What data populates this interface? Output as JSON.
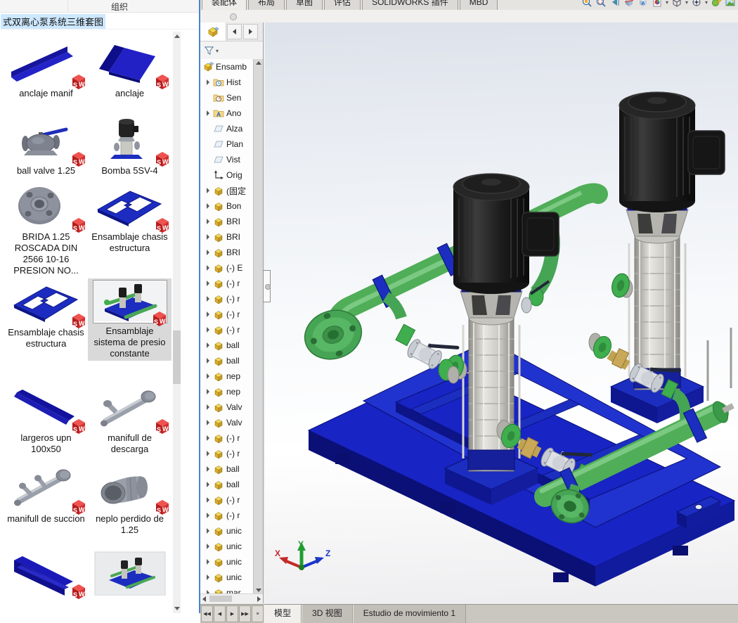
{
  "explorer": {
    "toolbar": {
      "organize": "组织"
    },
    "filename": "式双离心泵系统三维套图",
    "items": [
      {
        "label": "anclaje manif",
        "thumb": "angle-thin",
        "selected": false
      },
      {
        "label": "anclaje",
        "thumb": "angle-wide",
        "selected": false
      },
      {
        "label": "ball valve 1.25",
        "thumb": "ball-valve",
        "selected": false
      },
      {
        "label": "Bomba 5SV-4",
        "thumb": "pump-vertical",
        "selected": false
      },
      {
        "label": "BRIDA 1.25 ROSCADA DIN 2566 10-16 PRESION NO...",
        "thumb": "flange",
        "selected": false
      },
      {
        "label": "Ensamblaje chasis estructura",
        "thumb": "chassis",
        "selected": false
      },
      {
        "label": "Ensamblaje chasis estructura",
        "thumb": "chassis",
        "selected": false
      },
      {
        "label": "Ensamblaje sistema de presio constante",
        "thumb": "pump-skid",
        "selected": true
      },
      {
        "label": "largeros upn 100x50",
        "thumb": "channel-long",
        "selected": false
      },
      {
        "label": "manifull de descarga",
        "thumb": "manifold-descarga",
        "selected": false
      },
      {
        "label": "manifull de succion",
        "thumb": "manifold-succion",
        "selected": false
      },
      {
        "label": "neplo perdido de 1.25",
        "thumb": "coupling",
        "selected": false
      },
      {
        "label": "",
        "thumb": "channel-big",
        "selected": false
      },
      {
        "label": "",
        "thumb": "skid-photo",
        "selected": false
      }
    ]
  },
  "solidworks": {
    "commandmanager_tabs": [
      "装配体",
      "布局",
      "草图",
      "评估",
      "SOLIDWORKS 插件",
      "MBD"
    ],
    "headsup_icons": [
      "zoom-fit",
      "zoom-area",
      "previous-view",
      "section-view",
      "annotation-view",
      "appearance",
      "display-style",
      "view-orientation",
      "edit-appearance",
      "apply-scene"
    ],
    "featuretree": {
      "items": [
        {
          "icon": "assembly",
          "label": "Ensamb",
          "arrow": false,
          "indent": 0
        },
        {
          "icon": "history",
          "label": "Hist",
          "arrow": true,
          "indent": 1
        },
        {
          "icon": "sensors",
          "label": "Sen",
          "arrow": false,
          "indent": 1
        },
        {
          "icon": "annotations",
          "label": "Ano",
          "arrow": true,
          "indent": 1
        },
        {
          "icon": "plane",
          "label": "Alza",
          "arrow": false,
          "indent": 1
        },
        {
          "icon": "plane",
          "label": "Plan",
          "arrow": false,
          "indent": 1
        },
        {
          "icon": "plane",
          "label": "Vist",
          "arrow": false,
          "indent": 1
        },
        {
          "icon": "origin",
          "label": "Orig",
          "arrow": false,
          "indent": 1
        },
        {
          "icon": "part",
          "label": "(固定",
          "arrow": true,
          "indent": 1
        },
        {
          "icon": "part",
          "label": "Bon",
          "arrow": true,
          "indent": 1
        },
        {
          "icon": "part",
          "label": "BRI",
          "arrow": true,
          "indent": 1
        },
        {
          "icon": "part",
          "label": "BRI",
          "arrow": true,
          "indent": 1
        },
        {
          "icon": "part",
          "label": "BRI",
          "arrow": true,
          "indent": 1
        },
        {
          "icon": "part",
          "label": "(-) E",
          "arrow": true,
          "indent": 1
        },
        {
          "icon": "part",
          "label": "(-) r",
          "arrow": true,
          "indent": 1
        },
        {
          "icon": "part",
          "label": "(-) r",
          "arrow": true,
          "indent": 1
        },
        {
          "icon": "part",
          "label": "(-) r",
          "arrow": true,
          "indent": 1
        },
        {
          "icon": "part",
          "label": "(-) r",
          "arrow": true,
          "indent": 1
        },
        {
          "icon": "part",
          "label": "ball",
          "arrow": true,
          "indent": 1
        },
        {
          "icon": "part",
          "label": "ball",
          "arrow": true,
          "indent": 1
        },
        {
          "icon": "part",
          "label": "nep",
          "arrow": true,
          "indent": 1
        },
        {
          "icon": "part",
          "label": "nep",
          "arrow": true,
          "indent": 1
        },
        {
          "icon": "part",
          "label": "Valv",
          "arrow": true,
          "indent": 1
        },
        {
          "icon": "part",
          "label": "Valv",
          "arrow": true,
          "indent": 1
        },
        {
          "icon": "part",
          "label": "(-) r",
          "arrow": true,
          "indent": 1
        },
        {
          "icon": "part",
          "label": "(-) r",
          "arrow": true,
          "indent": 1
        },
        {
          "icon": "part",
          "label": "ball",
          "arrow": true,
          "indent": 1
        },
        {
          "icon": "part",
          "label": "ball",
          "arrow": true,
          "indent": 1
        },
        {
          "icon": "part",
          "label": "(-) r",
          "arrow": true,
          "indent": 1
        },
        {
          "icon": "part",
          "label": "(-) r",
          "arrow": true,
          "indent": 1
        },
        {
          "icon": "part",
          "label": "unic",
          "arrow": true,
          "indent": 1
        },
        {
          "icon": "part",
          "label": "unic",
          "arrow": true,
          "indent": 1
        },
        {
          "icon": "part",
          "label": "unic",
          "arrow": true,
          "indent": 1
        },
        {
          "icon": "part",
          "label": "unic",
          "arrow": true,
          "indent": 1
        },
        {
          "icon": "part",
          "label": "mar",
          "arrow": true,
          "indent": 1
        }
      ]
    },
    "motionbar": {
      "tabs": [
        "模型",
        "3D 视图",
        "Estudio de movimiento 1"
      ],
      "active_tab": "模型"
    },
    "triad": {
      "x": "X",
      "y": "Y",
      "z": "Z"
    },
    "colors": {
      "frame_blue": "#1b2ec0",
      "pipe_green": "#4fae57",
      "flange_green": "#3fae4e",
      "motor_black": "#1c1c1c",
      "pump_gray": "#c9c7c1",
      "brass": "#c0a352",
      "sw_badge_red": "#d32f2f",
      "selection_gray": "#d9d9d9",
      "filename_highlight": "#cde8ff"
    }
  }
}
